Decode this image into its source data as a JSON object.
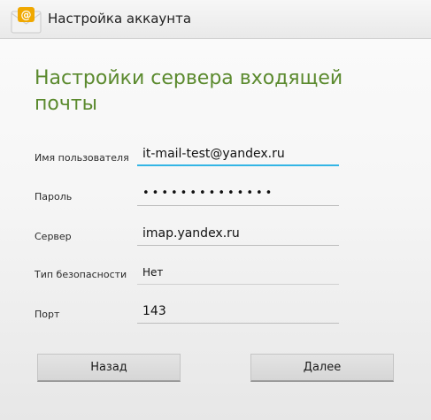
{
  "action_bar": {
    "icon": "email-app-icon",
    "title": "Настройка аккаунта"
  },
  "heading": "Настройки сервера входящей почты",
  "fields": [
    {
      "label": "Имя пользователя",
      "value": "it-mail-test@yandex.ru"
    },
    {
      "label": "Пароль",
      "value": "••••••••••••••"
    },
    {
      "label": "Сервер",
      "value": "imap.yandex.ru"
    },
    {
      "label": "Тип безопасности",
      "value": "Нет"
    },
    {
      "label": "Порт",
      "value": "143"
    }
  ],
  "buttons": {
    "back": "Назад",
    "next": "Далее"
  },
  "colors": {
    "heading": "#5b8a2e",
    "focus_underline": "#33b5e5",
    "icon_accent": "#f0a800"
  }
}
